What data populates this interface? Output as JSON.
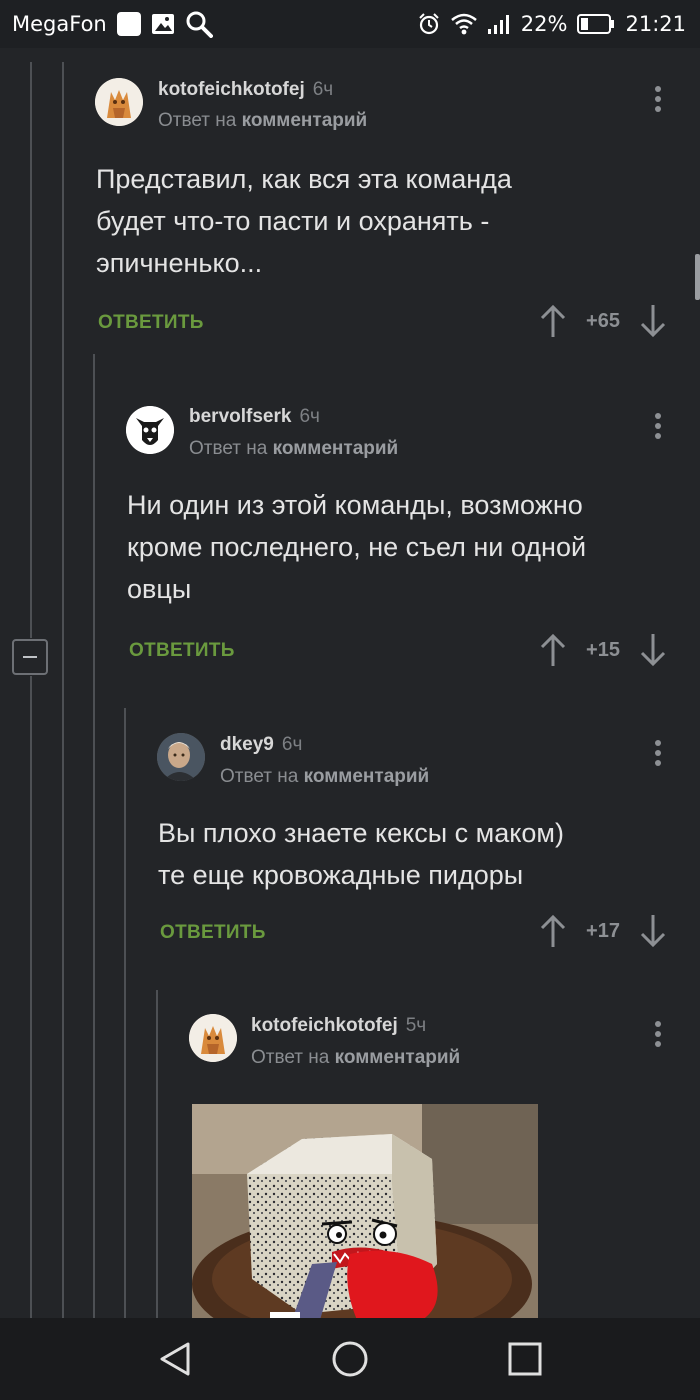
{
  "status_bar": {
    "carrier": "MegaFon",
    "battery": "22%",
    "time": "21:21"
  },
  "comments": [
    {
      "author": "kotofeichkotofej",
      "time": "6ч",
      "reply_prefix": "Ответ на",
      "reply_target": "комментарий",
      "text_lines": [
        "Представил, как вся эта команда",
        "будет что-то пасти и охранять -",
        "эпичненько..."
      ],
      "reply_label": "ОТВЕТИТЬ",
      "score": "+65"
    },
    {
      "author": "bervolfserk",
      "time": "6ч",
      "reply_prefix": "Ответ на",
      "reply_target": "комментарий",
      "text_lines": [
        "Ни один из этой команды, возможно",
        "кроме последнего, не съел ни одной",
        "овцы"
      ],
      "reply_label": "ОТВЕТИТЬ",
      "score": "+15"
    },
    {
      "author": "dkey9",
      "time": "6ч",
      "reply_prefix": "Ответ на",
      "reply_target": "комментарий",
      "text_lines": [
        "Вы плохо знаете кексы с маком)",
        "те еще кровожадные пидоры"
      ],
      "reply_label": "ОТВЕТИТЬ",
      "score": "+17"
    },
    {
      "author": "kotofeichkotofej",
      "time": "5ч",
      "reply_prefix": "Ответ на",
      "reply_target": "комментарий"
    }
  ],
  "icons": {
    "status": [
      "gallery-icon",
      "search-icon",
      "alarm-icon",
      "wifi-icon",
      "signal-icon",
      "battery-icon"
    ],
    "vote": [
      "upvote-arrow-icon",
      "downvote-arrow-icon"
    ],
    "nav": [
      "back-icon",
      "home-icon",
      "recents-icon"
    ]
  }
}
